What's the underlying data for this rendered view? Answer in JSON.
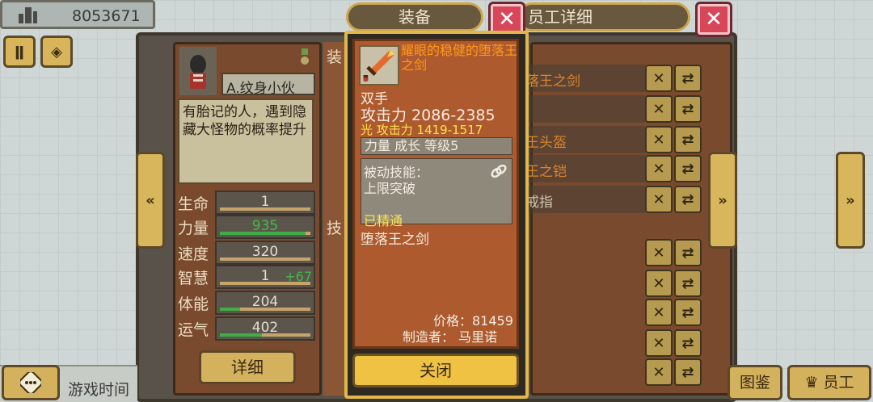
{
  "top_left": {
    "money": "8053671"
  },
  "equipment_modal": {
    "title": "装备",
    "item_name": "耀眼的稳健的堕落王之剑",
    "hand_type": "双手",
    "attack": "攻击力 2086-2385",
    "light_attack": "光 攻击力 1419-1517",
    "growth_info": "力量 成长 等级5",
    "passive_skill_label": "被动技能：",
    "passive_skill": "上限突破",
    "mastery": "已精通",
    "set_name": "堕落王之剑",
    "price": "价格：81459",
    "maker": "制造者： 马里诺",
    "close_button": "关闭"
  },
  "employee_panel": {
    "title": "员工详细",
    "name": "A.纹身小伙",
    "description": "有胎记的人，遇到隐藏大怪物的概率提升",
    "stats": [
      {
        "label": "生命",
        "value": "1",
        "bonus": "",
        "fill": 0
      },
      {
        "label": "力量",
        "value": "935",
        "bonus": "",
        "fill": 0.95,
        "value_color": "#3fbd48"
      },
      {
        "label": "速度",
        "value": "320",
        "bonus": "",
        "fill": 0
      },
      {
        "label": "智慧",
        "value": "1",
        "bonus": "+67",
        "fill": 0
      },
      {
        "label": "体能",
        "value": "204",
        "bonus": "",
        "fill": 0.22
      },
      {
        "label": "运气",
        "value": "402",
        "bonus": "",
        "fill": 0.46
      }
    ],
    "detail_button": "详细",
    "section_equip": "装",
    "section_skill": "技",
    "equip_items": [
      "落王之剑",
      "",
      "王头盔",
      "王之铠",
      "戒指"
    ]
  },
  "bottom": {
    "game_time": "游戏时间",
    "atlas_button": "图鉴",
    "staff_button": "员工"
  },
  "colors": {
    "item_name": "#ff9a1a",
    "gold_text": "#ffe34a",
    "close_red": "#d8465a",
    "plate_gold": "#cda54d"
  }
}
